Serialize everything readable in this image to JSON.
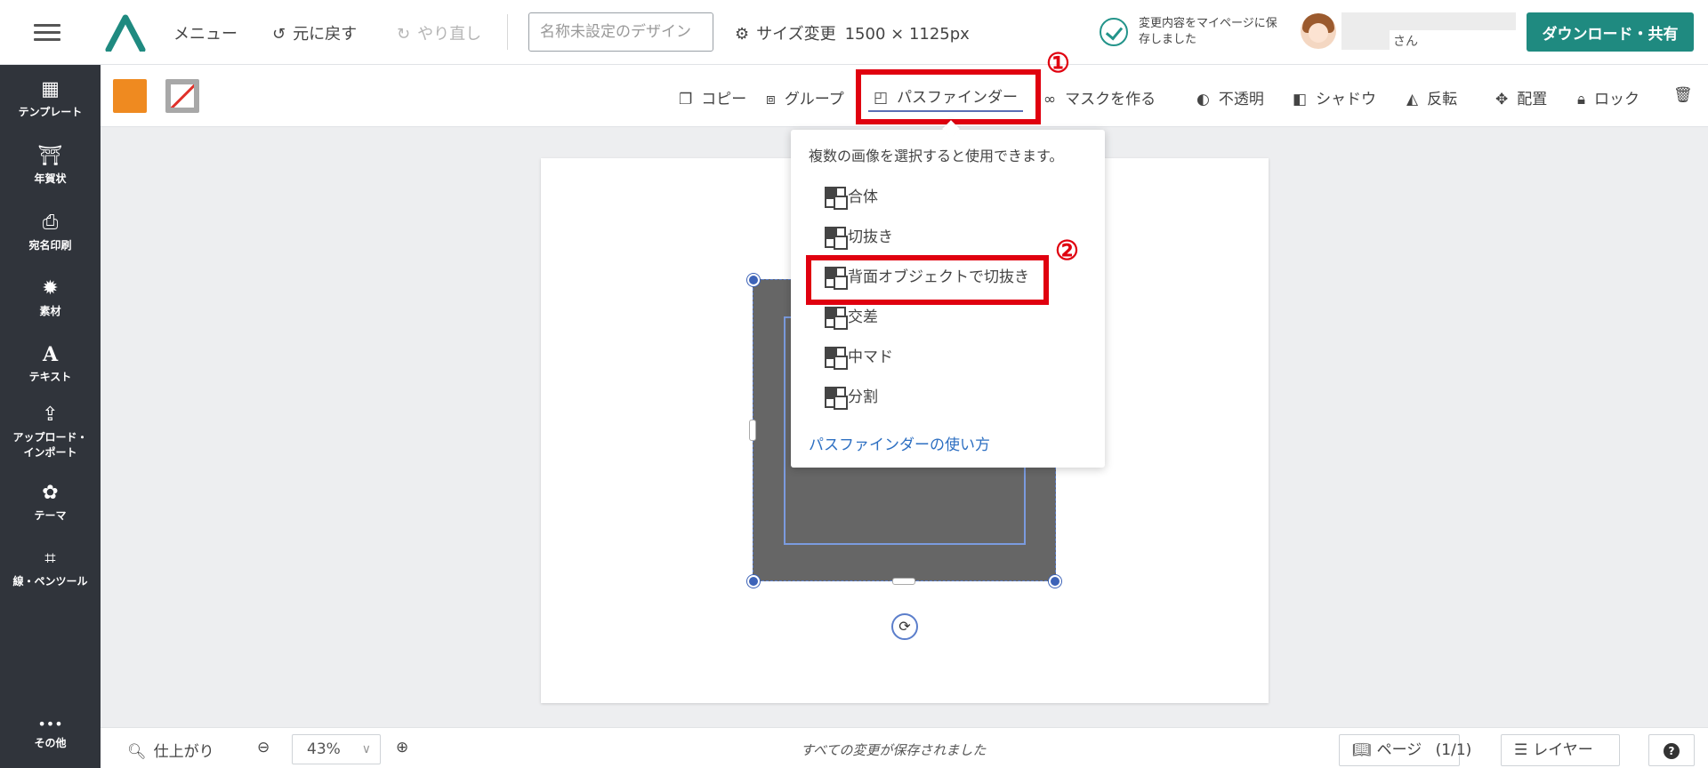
{
  "topbar": {
    "menu_label": "メニュー",
    "undo_label": "元に戻す",
    "redo_label": "やり直し",
    "design_name_placeholder": "名称未設定のデザイン",
    "resize_label": "サイズ変更",
    "dimensions": "1500 × 1125px",
    "save_status": "変更内容をマイページに保存しました",
    "user_suffix": "さん",
    "download_label": "ダウンロード・共有"
  },
  "sidebar": {
    "items": [
      {
        "label": "テンプレート",
        "icon": "template-icon"
      },
      {
        "label": "年賀状",
        "icon": "kagami-mochi-icon"
      },
      {
        "label": "宛名印刷",
        "icon": "printer-icon"
      },
      {
        "label": "素材",
        "icon": "gear-icon"
      },
      {
        "label": "テキスト",
        "icon": "text-icon"
      },
      {
        "label": "アップロード・インポート",
        "icon": "upload-file-icon"
      },
      {
        "label": "テーマ",
        "icon": "palette-icon"
      },
      {
        "label": "線・ペンツール",
        "icon": "pen-tool-icon"
      }
    ],
    "more_label": "その他"
  },
  "toolbar": {
    "copy": "コピー",
    "group": "グループ",
    "pathfinder": "パスファインダー",
    "mask": "マスクを作る",
    "opacity": "不透明",
    "shadow": "シャドウ",
    "flip": "反転",
    "arrange": "配置",
    "lock": "ロック"
  },
  "colors": {
    "fill": "#ef8a20",
    "accent": "#1f8a80",
    "highlight": "#e0000f"
  },
  "annotations": {
    "one": "①",
    "two": "②"
  },
  "pathfinder_menu": {
    "note": "複数の画像を選択すると使用できます。",
    "items": [
      "合体",
      "切抜き",
      "背面オブジェクトで切抜き",
      "交差",
      "中マド",
      "分割"
    ],
    "help_link": "パスファインダーの使い方"
  },
  "bottombar": {
    "preview": "仕上がり",
    "zoom": "43%",
    "status": "すべての変更が保存されました",
    "pages": "ページ",
    "page_count": "(1/1)",
    "layers": "レイヤー",
    "help": "?"
  }
}
